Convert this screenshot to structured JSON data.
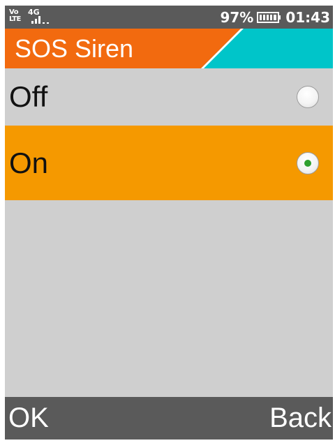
{
  "status_bar": {
    "volte_top": "Vo",
    "volte_bottom": "LTE",
    "network_type": "4G",
    "battery_percent": "97%",
    "battery_level": 0.97,
    "time": "01:43",
    "icons": [
      "volte-icon",
      "signal-icon",
      "battery-icon"
    ]
  },
  "title": "SOS Siren",
  "options": [
    {
      "label": "Off",
      "selected": false
    },
    {
      "label": "On",
      "selected": true
    }
  ],
  "softkeys": {
    "left": "OK",
    "right": "Back"
  },
  "colors": {
    "status_bar": "#5a5a5a",
    "title_orange": "#f26a0f",
    "title_teal": "#00c5c9",
    "list_background": "#cfcfcf",
    "selected_row": "#f59900",
    "radio_dot": "#2fa02f"
  }
}
